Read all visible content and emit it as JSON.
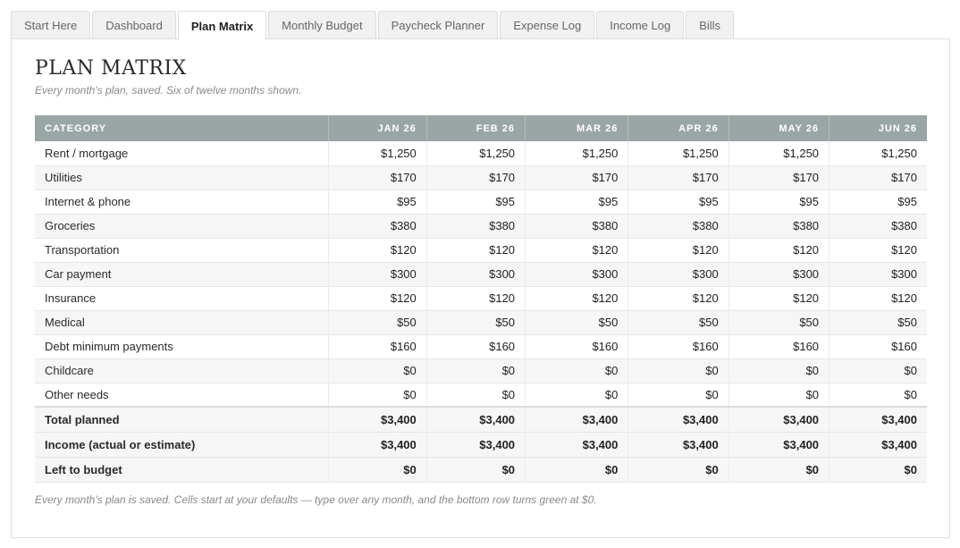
{
  "tabs": [
    {
      "label": "Start Here",
      "active": false
    },
    {
      "label": "Dashboard",
      "active": false
    },
    {
      "label": "Plan Matrix",
      "active": true
    },
    {
      "label": "Monthly Budget",
      "active": false
    },
    {
      "label": "Paycheck Planner",
      "active": false
    },
    {
      "label": "Expense Log",
      "active": false
    },
    {
      "label": "Income Log",
      "active": false
    },
    {
      "label": "Bills",
      "active": false
    }
  ],
  "page": {
    "title": "PLAN MATRIX",
    "subtitle": "Every month's plan, saved. Six of twelve months shown.",
    "footnote": "Every month's plan is saved. Cells start at your defaults — type over any month, and the bottom row turns green at $0."
  },
  "table": {
    "headers": [
      "CATEGORY",
      "JAN 26",
      "FEB 26",
      "MAR 26",
      "APR 26",
      "MAY 26",
      "JUN 26"
    ],
    "rows": [
      {
        "category": "Rent / mortgage",
        "values": [
          "$1,250",
          "$1,250",
          "$1,250",
          "$1,250",
          "$1,250",
          "$1,250"
        ]
      },
      {
        "category": "Utilities",
        "values": [
          "$170",
          "$170",
          "$170",
          "$170",
          "$170",
          "$170"
        ]
      },
      {
        "category": "Internet & phone",
        "values": [
          "$95",
          "$95",
          "$95",
          "$95",
          "$95",
          "$95"
        ]
      },
      {
        "category": "Groceries",
        "values": [
          "$380",
          "$380",
          "$380",
          "$380",
          "$380",
          "$380"
        ]
      },
      {
        "category": "Transportation",
        "values": [
          "$120",
          "$120",
          "$120",
          "$120",
          "$120",
          "$120"
        ]
      },
      {
        "category": "Car payment",
        "values": [
          "$300",
          "$300",
          "$300",
          "$300",
          "$300",
          "$300"
        ]
      },
      {
        "category": "Insurance",
        "values": [
          "$120",
          "$120",
          "$120",
          "$120",
          "$120",
          "$120"
        ]
      },
      {
        "category": "Medical",
        "values": [
          "$50",
          "$50",
          "$50",
          "$50",
          "$50",
          "$50"
        ]
      },
      {
        "category": "Debt minimum payments",
        "values": [
          "$160",
          "$160",
          "$160",
          "$160",
          "$160",
          "$160"
        ]
      },
      {
        "category": "Childcare",
        "values": [
          "$0",
          "$0",
          "$0",
          "$0",
          "$0",
          "$0"
        ]
      },
      {
        "category": "Other needs",
        "values": [
          "$0",
          "$0",
          "$0",
          "$0",
          "$0",
          "$0"
        ]
      }
    ],
    "summary": [
      {
        "category": "Total planned",
        "values": [
          "$3,400",
          "$3,400",
          "$3,400",
          "$3,400",
          "$3,400",
          "$3,400"
        ]
      },
      {
        "category": "Income (actual or estimate)",
        "values": [
          "$3,400",
          "$3,400",
          "$3,400",
          "$3,400",
          "$3,400",
          "$3,400"
        ]
      },
      {
        "category": "Left to budget",
        "values": [
          "$0",
          "$0",
          "$0",
          "$0",
          "$0",
          "$0"
        ]
      }
    ]
  }
}
